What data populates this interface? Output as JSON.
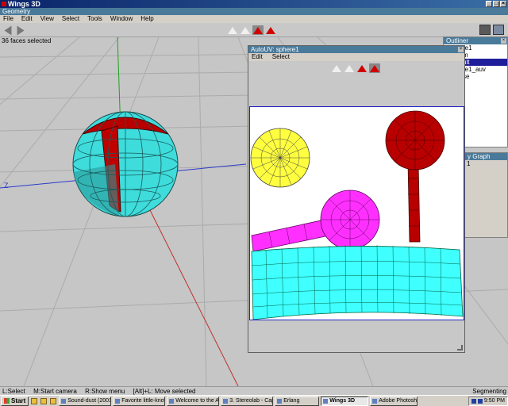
{
  "window": {
    "title": "Wings 3D",
    "min_glyph": "_",
    "max_glyph": "□",
    "close_glyph": "×"
  },
  "geometry": {
    "title": "Geometry"
  },
  "menu": [
    "File",
    "Edit",
    "View",
    "Select",
    "Tools",
    "Window",
    "Help"
  ],
  "status": {
    "selection": "36 faces selected"
  },
  "axis": {
    "z_label": "Z"
  },
  "outliner": {
    "title": "Outliner",
    "rows": [
      {
        "text": "re1",
        "selected": false
      },
      {
        "text": "m",
        "selected": false
      },
      {
        "text": "",
        "selected": false
      },
      {
        "text": "",
        "selected": false
      },
      {
        "text": "ult",
        "selected": true
      },
      {
        "text": "re1_auv",
        "selected": false
      },
      {
        "text": "se",
        "selected": false
      }
    ]
  },
  "geograph": {
    "title": "y Graph",
    "row": "1"
  },
  "autouv": {
    "title": "AutoUV: sphere1",
    "menu": [
      "Edit",
      "Select"
    ]
  },
  "hints": {
    "left": "L:Select",
    "middle": "M:Start camera",
    "right": "R:Show menu",
    "alt": "[Alt]+L: Move selected",
    "mode": "Segmenting"
  },
  "taskbar": {
    "start": "Start",
    "tasks": [
      {
        "label": "Sound-dust (2001)",
        "active": false
      },
      {
        "label": "Favorite little-know...",
        "active": false
      },
      {
        "label": "Welcome to the Art ...",
        "active": false
      },
      {
        "label": "3. Stereolab - Capt...",
        "active": false
      },
      {
        "label": "Erlang",
        "active": false
      },
      {
        "label": "Wings 3D",
        "active": true
      },
      {
        "label": "Adobe Photoshop",
        "active": false
      }
    ],
    "clock": "9:50 PM"
  },
  "colors": {
    "cyan": "#3fdcdc",
    "red": "#b80000",
    "yellow": "#ffff40",
    "magenta": "#ff30ff",
    "selected_blue": "#1e1e9a"
  }
}
